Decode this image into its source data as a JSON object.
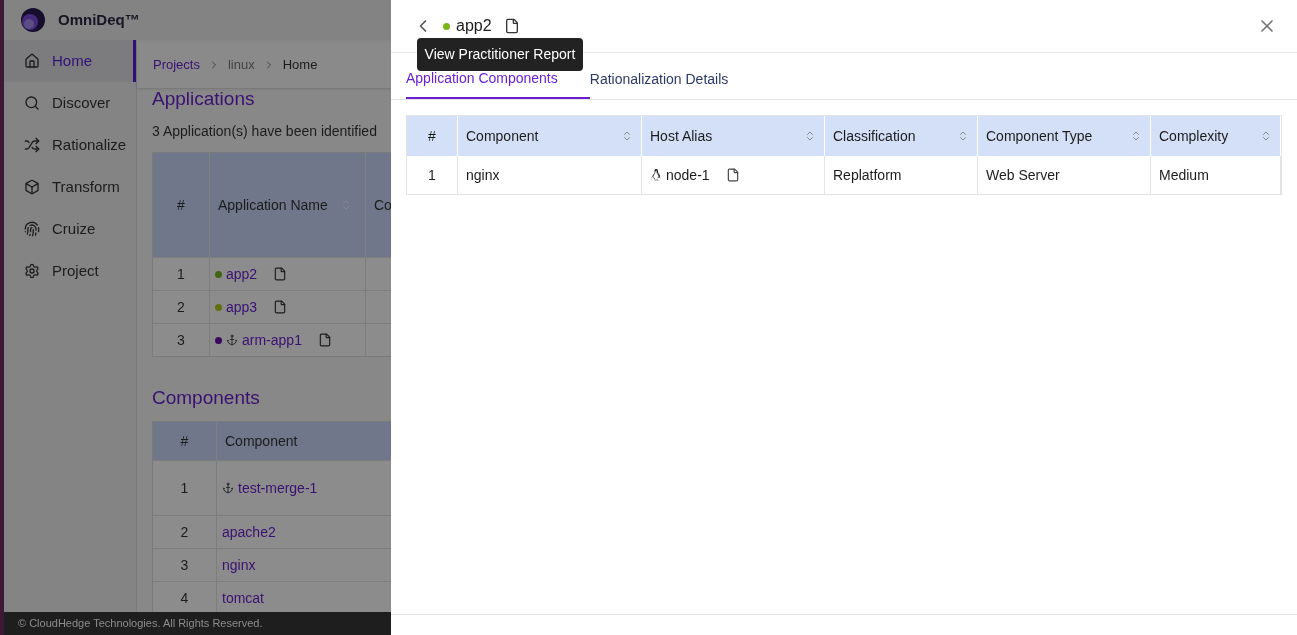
{
  "background": {
    "brand": "OmniDeq™",
    "sidebar": [
      {
        "label": "Home",
        "kind": "home",
        "selected": true
      },
      {
        "label": "Discover",
        "kind": "discover",
        "selected": false
      },
      {
        "label": "Rationalize",
        "kind": "rationalize",
        "selected": false
      },
      {
        "label": "Transform",
        "kind": "transform",
        "selected": false
      },
      {
        "label": "Cruize",
        "kind": "cruize",
        "selected": false
      },
      {
        "label": "Project",
        "kind": "project",
        "selected": false
      }
    ],
    "breadcrumb": [
      {
        "label": "Projects",
        "kind": "link"
      },
      {
        "label": "linux",
        "kind": "muted"
      },
      {
        "label": "Home",
        "kind": "current"
      }
    ],
    "applications": {
      "heading": "Applications",
      "summary": "3 Application(s) have been identified",
      "columns": [
        "#",
        "Application Name",
        "Co"
      ],
      "rows": [
        {
          "number": "1",
          "name": "app2",
          "color": "#446410",
          "merged": false
        },
        {
          "number": "2",
          "name": "app3",
          "color": "#63700d",
          "merged": false
        },
        {
          "number": "3",
          "name": "arm-app1",
          "color": "#3a075f",
          "merged": true
        }
      ]
    },
    "components": {
      "heading": "Components",
      "columns": [
        "#",
        "Component"
      ],
      "rows": [
        {
          "number": "1",
          "name": "test-merge-1",
          "merged": true
        },
        {
          "number": "2",
          "name": "apache2",
          "merged": false
        },
        {
          "number": "3",
          "name": "nginx",
          "merged": false
        },
        {
          "number": "4",
          "name": "tomcat",
          "merged": false
        }
      ]
    },
    "footer": "© CloudHedge Technologies. All Rights Reserved."
  },
  "drawer": {
    "title": "app2",
    "color": "#7cb518",
    "tooltip": "View Practitioner Report",
    "tabs": [
      {
        "label": "Application Components",
        "selected": true
      },
      {
        "label": "Rationalization Details",
        "selected": false
      }
    ],
    "table": {
      "columns": [
        "#",
        "Component",
        "Host Alias",
        "Classification",
        "Component Type",
        "Complexity"
      ],
      "rows": [
        {
          "number": "1",
          "component": "nginx",
          "host": "node-1",
          "classification": "Replatform",
          "type": "Web Server",
          "complexity": "Medium"
        }
      ]
    }
  }
}
